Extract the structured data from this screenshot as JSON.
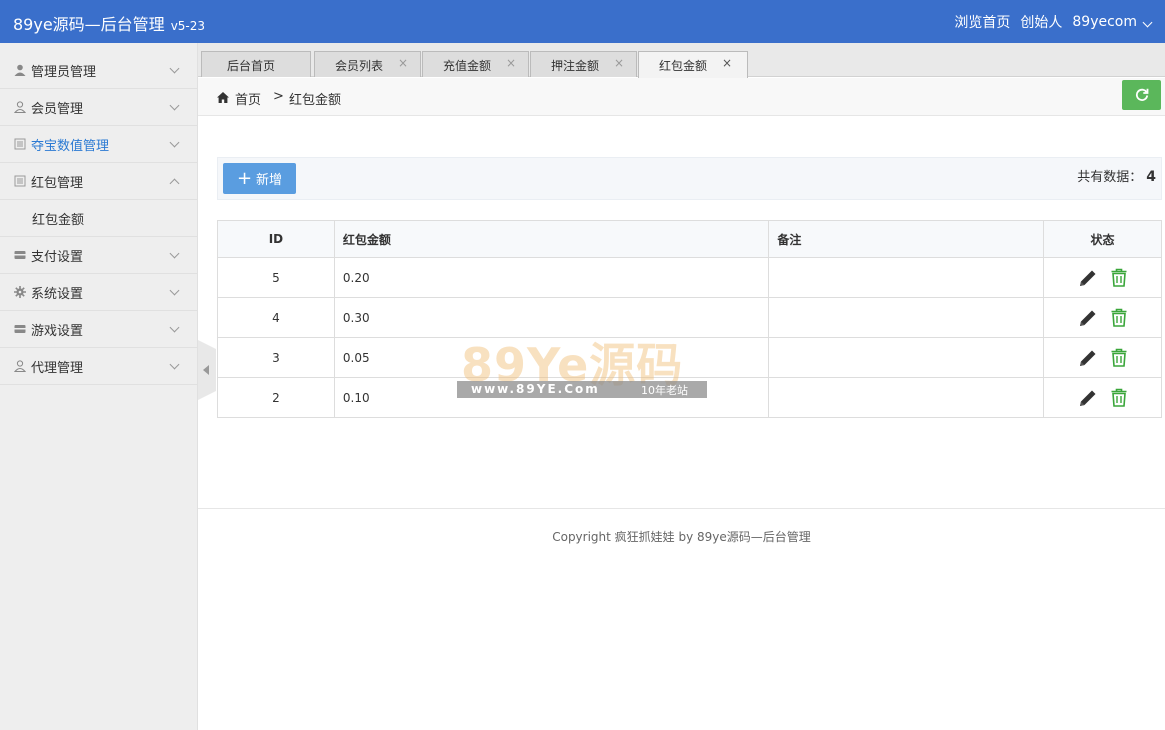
{
  "header": {
    "brand": "89ye源码—后台管理",
    "version": "v5-23",
    "links": [
      "浏览首页",
      "创始人",
      "89yecom"
    ]
  },
  "sidebar": {
    "items": [
      {
        "label": "管理员管理",
        "icon": "user-icon"
      },
      {
        "label": "会员管理",
        "icon": "user-outline-icon"
      },
      {
        "label": "夺宝数值管理",
        "icon": "list-icon",
        "active": true
      },
      {
        "label": "红包管理",
        "icon": "list-icon",
        "expanded": true
      },
      {
        "label": "支付设置",
        "icon": "card-icon"
      },
      {
        "label": "系统设置",
        "icon": "gear-icon"
      },
      {
        "label": "游戏设置",
        "icon": "card-icon"
      },
      {
        "label": "代理管理",
        "icon": "user-outline-icon"
      }
    ],
    "subitem": "红包金额"
  },
  "tabs": [
    {
      "label": "后台首页",
      "closable": false
    },
    {
      "label": "会员列表",
      "closable": true
    },
    {
      "label": "充值金额",
      "closable": true
    },
    {
      "label": "押注金额",
      "closable": true
    },
    {
      "label": "红包金额",
      "closable": true,
      "active": true
    }
  ],
  "tab_close": "×",
  "breadcrumb": {
    "home": "首页",
    "sep": ">",
    "current": "红包金额"
  },
  "toolbar": {
    "add_label": "新增",
    "add_icon": "+",
    "total_label": "共有数据：",
    "total_count": "4"
  },
  "table": {
    "columns": [
      "ID",
      "红包金额",
      "备注",
      "状态"
    ],
    "rows": [
      {
        "id": "5",
        "amount": "0.20",
        "note": ""
      },
      {
        "id": "4",
        "amount": "0.30",
        "note": ""
      },
      {
        "id": "3",
        "amount": "0.05",
        "note": ""
      },
      {
        "id": "2",
        "amount": "0.10",
        "note": ""
      }
    ]
  },
  "footer": "Copyright 疯狂抓娃娃 by 89ye源码—后台管理",
  "watermark": {
    "big": "89Ye源码",
    "url": "www.89YE.Com",
    "tag": "10年老站"
  },
  "colors": {
    "header": "#3a6fcb",
    "active_menu": "#2b7ad3",
    "add_button": "#5a9de0",
    "refresh_button": "#5bb75b",
    "delete_icon": "#3aa63a"
  }
}
